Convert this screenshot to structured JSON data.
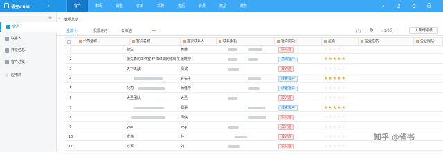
{
  "app": {
    "title": "悟空CRM"
  },
  "nav": [
    {
      "label": "客户",
      "active": true
    },
    {
      "label": "市场",
      "active": false
    },
    {
      "label": "销售",
      "active": false
    },
    {
      "label": "订单",
      "active": false
    },
    {
      "label": "采购",
      "active": false
    },
    {
      "label": "售后",
      "active": false
    },
    {
      "label": "会员",
      "active": false
    },
    {
      "label": "商品",
      "active": false
    },
    {
      "label": "财务",
      "active": false
    }
  ],
  "top_icons": [
    "search-icon",
    "bell-icon",
    "gear-icon",
    "user-icon"
  ],
  "sidebar": {
    "items": [
      {
        "label": "客户",
        "active": true,
        "icon": "customer-icon"
      },
      {
        "label": "联系人",
        "active": false,
        "icon": "contact-icon"
      },
      {
        "label": "开票信息",
        "active": false,
        "icon": "invoice-icon"
      },
      {
        "label": "客户总览",
        "active": false,
        "icon": "overview-icon"
      },
      {
        "label": "应用商",
        "active": false,
        "icon": "plus-icon"
      }
    ]
  },
  "breadcrumb": "数据总览",
  "tabs": [
    {
      "label": "全部",
      "active": true
    },
    {
      "label": "我跟进的",
      "active": false
    },
    {
      "label": "公海池",
      "active": false
    }
  ],
  "toolbar": {
    "pager": "1/6页",
    "new_label": "+ 新增记录"
  },
  "table": {
    "columns": [
      "公司全称",
      "客户名称",
      "首次联系人",
      "联系手机",
      "客户阶段",
      "星级",
      "企业性质",
      "企业网站"
    ],
    "rows": [
      {
        "no": "1",
        "company": "",
        "name": "独生",
        "contact": "姜姜",
        "stage": "没兴趣",
        "stage_color": "pink",
        "stars": 0
      },
      {
        "no": "2",
        "company": "",
        "name": "张先森的工作室-怀来卓润网络科技",
        "contact": "张晓宁",
        "stage": "意向客户",
        "stage_color": "blue",
        "stars": 5
      },
      {
        "no": "3",
        "company": "",
        "name": "天下无敌",
        "contact": "测试",
        "stage": "没兴趣",
        "stage_color": "pink",
        "stars": 0
      },
      {
        "no": "4",
        "company": "",
        "name": "",
        "contact": "袁先生",
        "stage": "线索客户",
        "stage_color": "blue",
        "stars": 5
      },
      {
        "no": "5",
        "company": "",
        "name": "公司",
        "contact": "杨佳华",
        "stage": "线索客户",
        "stage_color": "blue",
        "stars": 0
      },
      {
        "no": "6",
        "company": "",
        "name": "大圣团队",
        "contact": "大圣",
        "stage": "没兴趣",
        "stage_color": "pink",
        "stars": 0
      },
      {
        "no": "7",
        "company": "",
        "name": "",
        "contact": "骞哥",
        "stage": "线索客户",
        "stage_color": "blue",
        "stars": 5
      },
      {
        "no": "8",
        "company": "",
        "name": "",
        "contact": "周侠",
        "stage": "没兴趣",
        "stage_color": "pink",
        "stars": 0
      },
      {
        "no": "9",
        "company": "",
        "name": "yan",
        "contact": "zhp",
        "stage": "没兴趣",
        "stage_color": "pink",
        "stars": 0
      },
      {
        "no": "10",
        "company": "",
        "name": "宏伟",
        "contact": "孙",
        "stage": "没兴趣",
        "stage_color": "pink",
        "stars": 0
      },
      {
        "no": "11",
        "company": "",
        "name": "万军",
        "contact": "刘",
        "stage": "没兴趣",
        "stage_color": "pink",
        "stars": 0
      }
    ]
  },
  "watermark": "知乎 @雀书"
}
